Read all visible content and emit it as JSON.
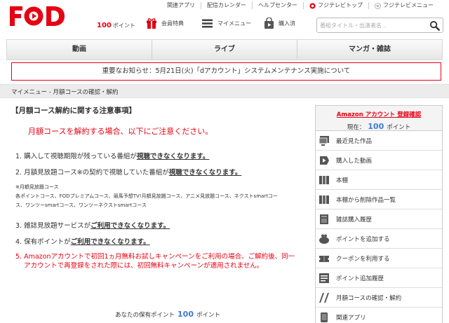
{
  "brand": {
    "logo_text": "FOD",
    "accent_color": "#e60012",
    "point_color": "#3a7bd5"
  },
  "topnav": [
    {
      "label": "関連アプリ"
    },
    {
      "label": "配信カレンダー"
    },
    {
      "label": "ヘルプセンター"
    },
    {
      "label": "フジテレビトップ",
      "icon": "fujitv-eye-icon"
    },
    {
      "label": "フジテレビメニュー",
      "icon": "chevron-down-icon"
    }
  ],
  "header": {
    "points_value": "100",
    "points_unit": "ポイント",
    "member_benefits": "会員特典",
    "my_menu": "マイメニュー",
    "purchased": "購入済",
    "search_placeholder": "番組タイトル・出演者名..."
  },
  "mainnav": [
    "動画",
    "ライブ",
    "マンガ・雑誌"
  ],
  "notice": "重要なお知らせ：5月21日(火)「dアカウント」システムメンテナンス実施について",
  "breadcrumb": "マイメニュー - 月額コースの確認・解約",
  "main": {
    "title": "【月額コース解約に関する注意事項】",
    "lead": "月額コースを解約する場合、以下にご注意ください。",
    "items": [
      {
        "pre": "1. 購入して視聴期限が残っている番組が",
        "emph": "視聴できなくなります。"
      },
      {
        "pre": "2. 月額見放題コース※の契約で視聴していた番組が",
        "emph": "視聴できなくなります。"
      },
      {
        "pre": "3. 雑誌見放題サービスが",
        "emph": "ご利用できなくなります。"
      },
      {
        "pre": "4. 保有ポイントが",
        "emph": "ご利用できなくなります。"
      }
    ],
    "note_title": "※月額見放題コース",
    "note_line1": "各ポイントコース、FODプレミアムコース、競馬予想TV!月額見放題コース、アニメ見放題コース、ネクストsmartコー",
    "note_line2": "ス、ワンツーsmartコース、ワンツーネクストsmartコース",
    "item5_num": "5.",
    "item5": "Amazonアカウントで初回1ヵ月無料お試しキャンペーンをご利用の場合、ご解約後、同一アカウントで再登録をされた際には、初回無料キャンペーンが適用されません。",
    "owned_label": "あなたの保有ポイント",
    "owned_value": "100",
    "owned_unit": "ポイント"
  },
  "sidebar": {
    "amazon_label": "Amazon アカウント 登録確認",
    "current_label": "現在：",
    "current_value": "100",
    "current_unit": "ポイント",
    "items": [
      {
        "label": "最近見た作品",
        "icon": "monitor-icon"
      },
      {
        "label": "購入した動画",
        "icon": "play-tag-icon"
      },
      {
        "label": "本棚",
        "icon": "bookshelf-icon"
      },
      {
        "label": "本棚から削除作品一覧",
        "icon": "bookshelf-remove-icon"
      },
      {
        "label": "雑誌購入履歴",
        "icon": "magazine-icon"
      },
      {
        "label": "ポイントを追加する",
        "icon": "coin-purse-icon"
      },
      {
        "label": "クーポンを利用する",
        "icon": "coupon-icon"
      },
      {
        "label": "ポイント追加履歴",
        "icon": "history-icon"
      },
      {
        "label": "月額コースの確認・解約",
        "icon": "course-icon"
      },
      {
        "label": "関連アプリ",
        "icon": "app-icon"
      }
    ]
  }
}
